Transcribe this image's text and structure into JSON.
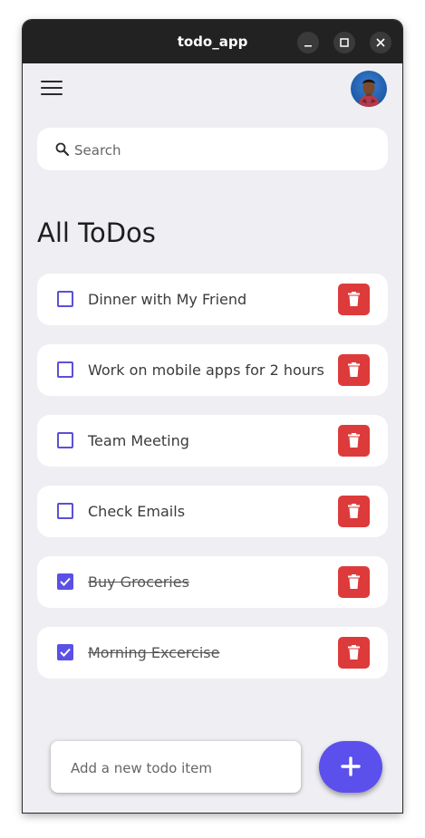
{
  "window": {
    "title": "todo_app"
  },
  "search": {
    "placeholder": "Search"
  },
  "heading": "All ToDos",
  "todos": [
    {
      "label": "Dinner with My Friend",
      "done": false
    },
    {
      "label": "Work on mobile apps for 2 hours",
      "done": false
    },
    {
      "label": "Team Meeting",
      "done": false
    },
    {
      "label": "Check Emails",
      "done": false
    },
    {
      "label": "Buy Groceries",
      "done": true
    },
    {
      "label": "Morning Excercise",
      "done": true
    }
  ],
  "add": {
    "placeholder": "Add a new todo item",
    "button_icon": "plus-icon"
  },
  "colors": {
    "accent": "#5b50ec",
    "delete": "#dd3b3b",
    "background": "#eeeef3",
    "titlebar": "#222222"
  }
}
